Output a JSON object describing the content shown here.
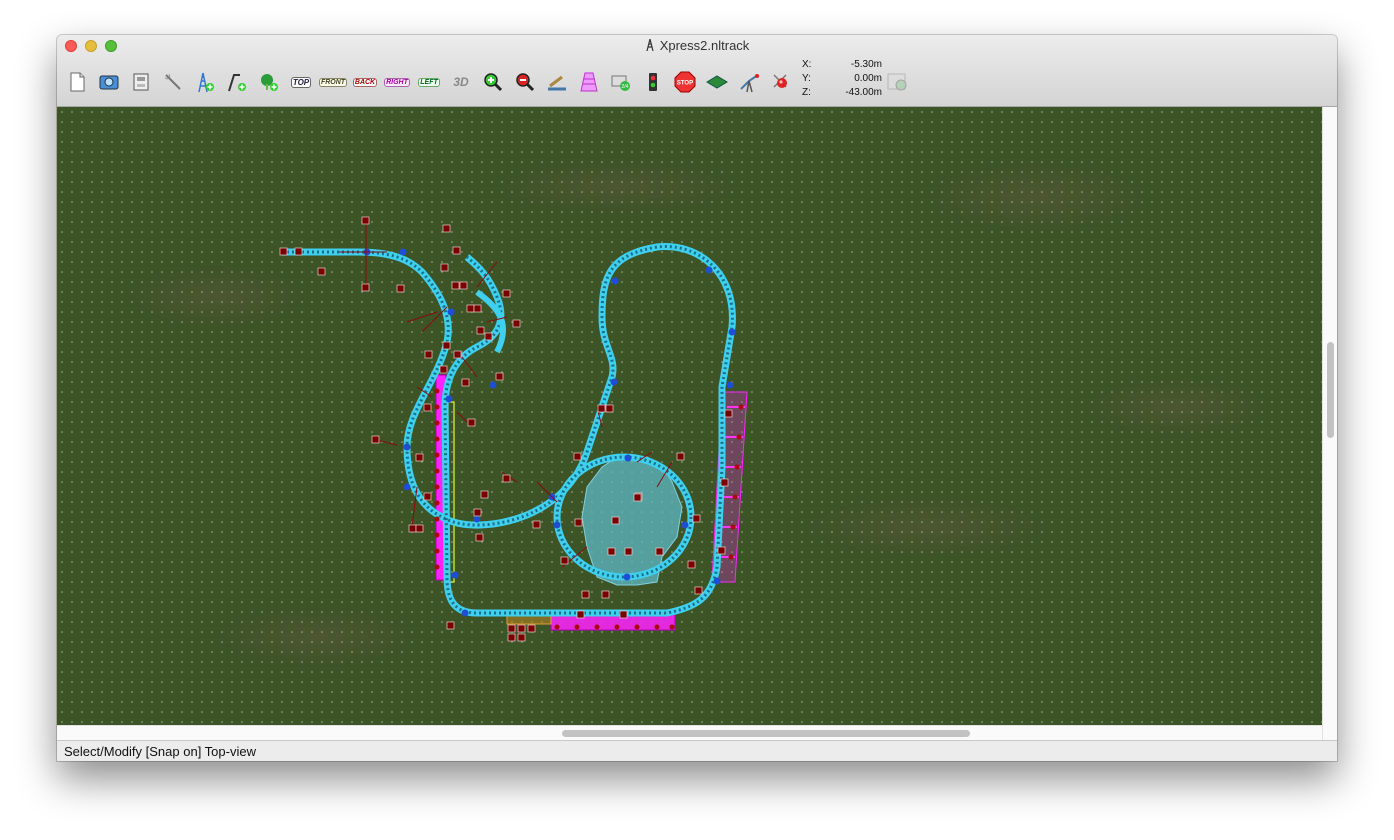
{
  "window": {
    "title": "Xpress2.nltrack"
  },
  "toolbar": {
    "buttons": [
      {
        "name": "new-document",
        "text": ""
      },
      {
        "name": "open-scenery",
        "text": ""
      },
      {
        "name": "save-file",
        "text": ""
      },
      {
        "name": "select-tool",
        "text": ""
      },
      {
        "name": "add-support",
        "text": ""
      },
      {
        "name": "add-track",
        "text": ""
      },
      {
        "name": "add-tree",
        "text": ""
      },
      {
        "name": "view-top",
        "text": "TOP"
      },
      {
        "name": "view-front",
        "text": "FRONT"
      },
      {
        "name": "view-back",
        "text": "BACK"
      },
      {
        "name": "view-right",
        "text": "RIGHT"
      },
      {
        "name": "view-left",
        "text": "LEFT"
      },
      {
        "name": "view-3d",
        "text": "3D"
      },
      {
        "name": "zoom-in",
        "text": ""
      },
      {
        "name": "zoom-out",
        "text": ""
      },
      {
        "name": "lift-hill",
        "text": ""
      },
      {
        "name": "station",
        "text": ""
      },
      {
        "name": "transfer-section",
        "text": ""
      },
      {
        "name": "block-signal",
        "text": ""
      },
      {
        "name": "stop-brake",
        "text": "STOP"
      },
      {
        "name": "terrain",
        "text": ""
      },
      {
        "name": "catwalk",
        "text": ""
      },
      {
        "name": "marker",
        "text": ""
      },
      {
        "name": "scenery-disabled",
        "text": ""
      }
    ]
  },
  "coordinates": {
    "x_label": "X:",
    "x_value": "-5.30m",
    "y_label": "Y:",
    "y_value": "0.00m",
    "z_label": "Z:",
    "z_value": "-43.00m"
  },
  "status": {
    "text": "Select/Modify [Snap on] Top-view"
  },
  "colors": {
    "track": "#3fd0f0",
    "node": "#1d4fd6",
    "support": "#8a0a0a",
    "station": "#ff22ff",
    "water": "#5fb8c8",
    "grass": "#3d5427"
  }
}
